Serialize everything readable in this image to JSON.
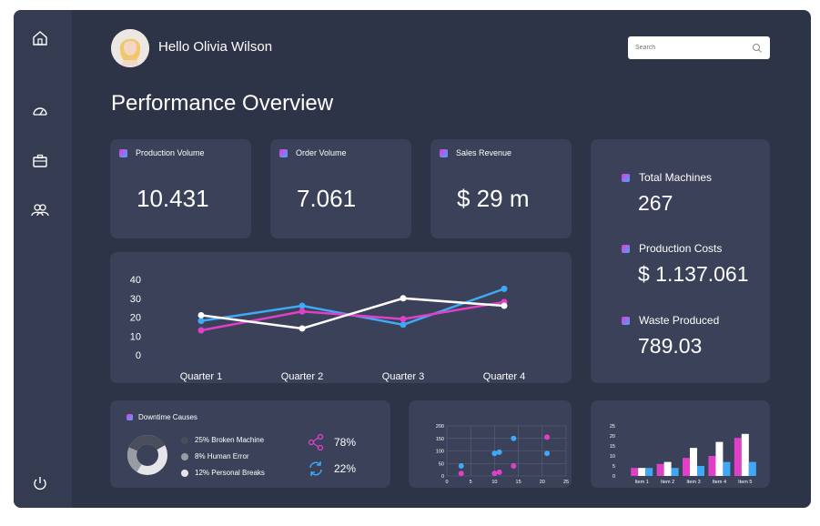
{
  "header": {
    "greeting": "Hello Olivia Wilson",
    "search_placeholder": "Search",
    "page_title": "Performance Overview"
  },
  "sidebar": {
    "icons": [
      "home-icon",
      "dashboard-gauge-icon",
      "briefcase-icon",
      "users-icon",
      "power-icon"
    ]
  },
  "stats": [
    {
      "label": "Production Volume",
      "value": "10.431"
    },
    {
      "label": "Order Volume",
      "value": "7.061"
    },
    {
      "label": "Sales Revenue",
      "value": "$ 29 m"
    }
  ],
  "side_stats": [
    {
      "label": "Total Machines",
      "value": "267"
    },
    {
      "label": "Production Costs",
      "value": "$ 1.137.061"
    },
    {
      "label": "Waste Produced",
      "value": "789.03"
    }
  ],
  "downtime": {
    "title": "Downtime Causes",
    "items": [
      {
        "label": "25% Broken Machine",
        "color": "#4a4d5a"
      },
      {
        "label": "8% Human Error",
        "color": "#9a9ca4"
      },
      {
        "label": "12% Personal Breaks",
        "color": "#e6e6ea"
      }
    ],
    "share_pct": "78%",
    "refresh_pct": "22%"
  },
  "colors": {
    "blue": "#3fa9f5",
    "magenta": "#e040c8",
    "white": "#ffffff",
    "card": "#3a4158",
    "bg": "#2e3448"
  },
  "chart_data": [
    {
      "type": "line",
      "categories": [
        "Quarter 1",
        "Quarter 2",
        "Quarter 3",
        "Quarter 4"
      ],
      "ylim": [
        0,
        40
      ],
      "yticks": [
        0,
        10,
        20,
        30,
        40
      ],
      "series": [
        {
          "color": "#3fa9f5",
          "values": [
            18,
            26,
            16,
            35
          ]
        },
        {
          "color": "#e040c8",
          "values": [
            13,
            23,
            19,
            28
          ]
        },
        {
          "color": "#ffffff",
          "values": [
            21,
            14,
            30,
            26
          ]
        }
      ]
    },
    {
      "type": "scatter",
      "xlim": [
        0,
        25
      ],
      "ylim": [
        0,
        200
      ],
      "xticks": [
        0,
        5,
        10,
        15,
        20,
        25
      ],
      "yticks": [
        0,
        50,
        100,
        150,
        200
      ],
      "grid": true,
      "series": [
        {
          "color": "#3fa9f5",
          "points": [
            [
              3,
              40
            ],
            [
              10,
              90
            ],
            [
              11,
              95
            ],
            [
              14,
              150
            ],
            [
              21,
              90
            ]
          ]
        },
        {
          "color": "#e040c8",
          "points": [
            [
              3,
              10
            ],
            [
              10,
              10
            ],
            [
              11,
              15
            ],
            [
              14,
              40
            ],
            [
              21,
              155
            ]
          ]
        }
      ]
    },
    {
      "type": "bar",
      "categories": [
        "Item 1",
        "Item 2",
        "Item 3",
        "Item 4",
        "Item 5"
      ],
      "ylim": [
        0,
        25
      ],
      "yticks": [
        0,
        5,
        10,
        15,
        20,
        25
      ],
      "series": [
        {
          "color": "#e040c8",
          "values": [
            4,
            6,
            9,
            10,
            19
          ]
        },
        {
          "color": "#ffffff",
          "values": [
            4,
            7,
            14,
            17,
            21
          ]
        },
        {
          "color": "#3fa9f5",
          "values": [
            4,
            4,
            5,
            7,
            7
          ]
        }
      ]
    }
  ]
}
